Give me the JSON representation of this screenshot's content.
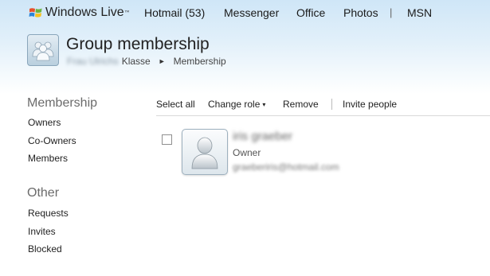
{
  "topnav": {
    "brand": "Windows Live",
    "brand_tm": "™",
    "items": {
      "hotmail": "Hotmail (53)",
      "messenger": "Messenger",
      "office": "Office",
      "photos": "Photos",
      "separator": "|",
      "msn": "MSN"
    }
  },
  "page": {
    "title": "Group membership",
    "breadcrumb": {
      "owner_blurred": "Frau Ulrichs",
      "group": "Klasse",
      "arrow": "►",
      "current": "Membership"
    }
  },
  "sidebar": {
    "membership_heading": "Membership",
    "membership_items": {
      "owners": "Owners",
      "coowners": "Co-Owners",
      "members": "Members"
    },
    "other_heading": "Other",
    "other_items": {
      "requests": "Requests",
      "invites": "Invites",
      "blocked": "Blocked"
    }
  },
  "toolbar": {
    "select_all": "Select all",
    "change_role": "Change role",
    "change_role_caret": "▾",
    "remove": "Remove",
    "invite_people": "Invite people"
  },
  "member": {
    "name_blurred": "iris graeber",
    "role": "Owner",
    "email_blurred": "graeberiris@hotmail.com"
  }
}
